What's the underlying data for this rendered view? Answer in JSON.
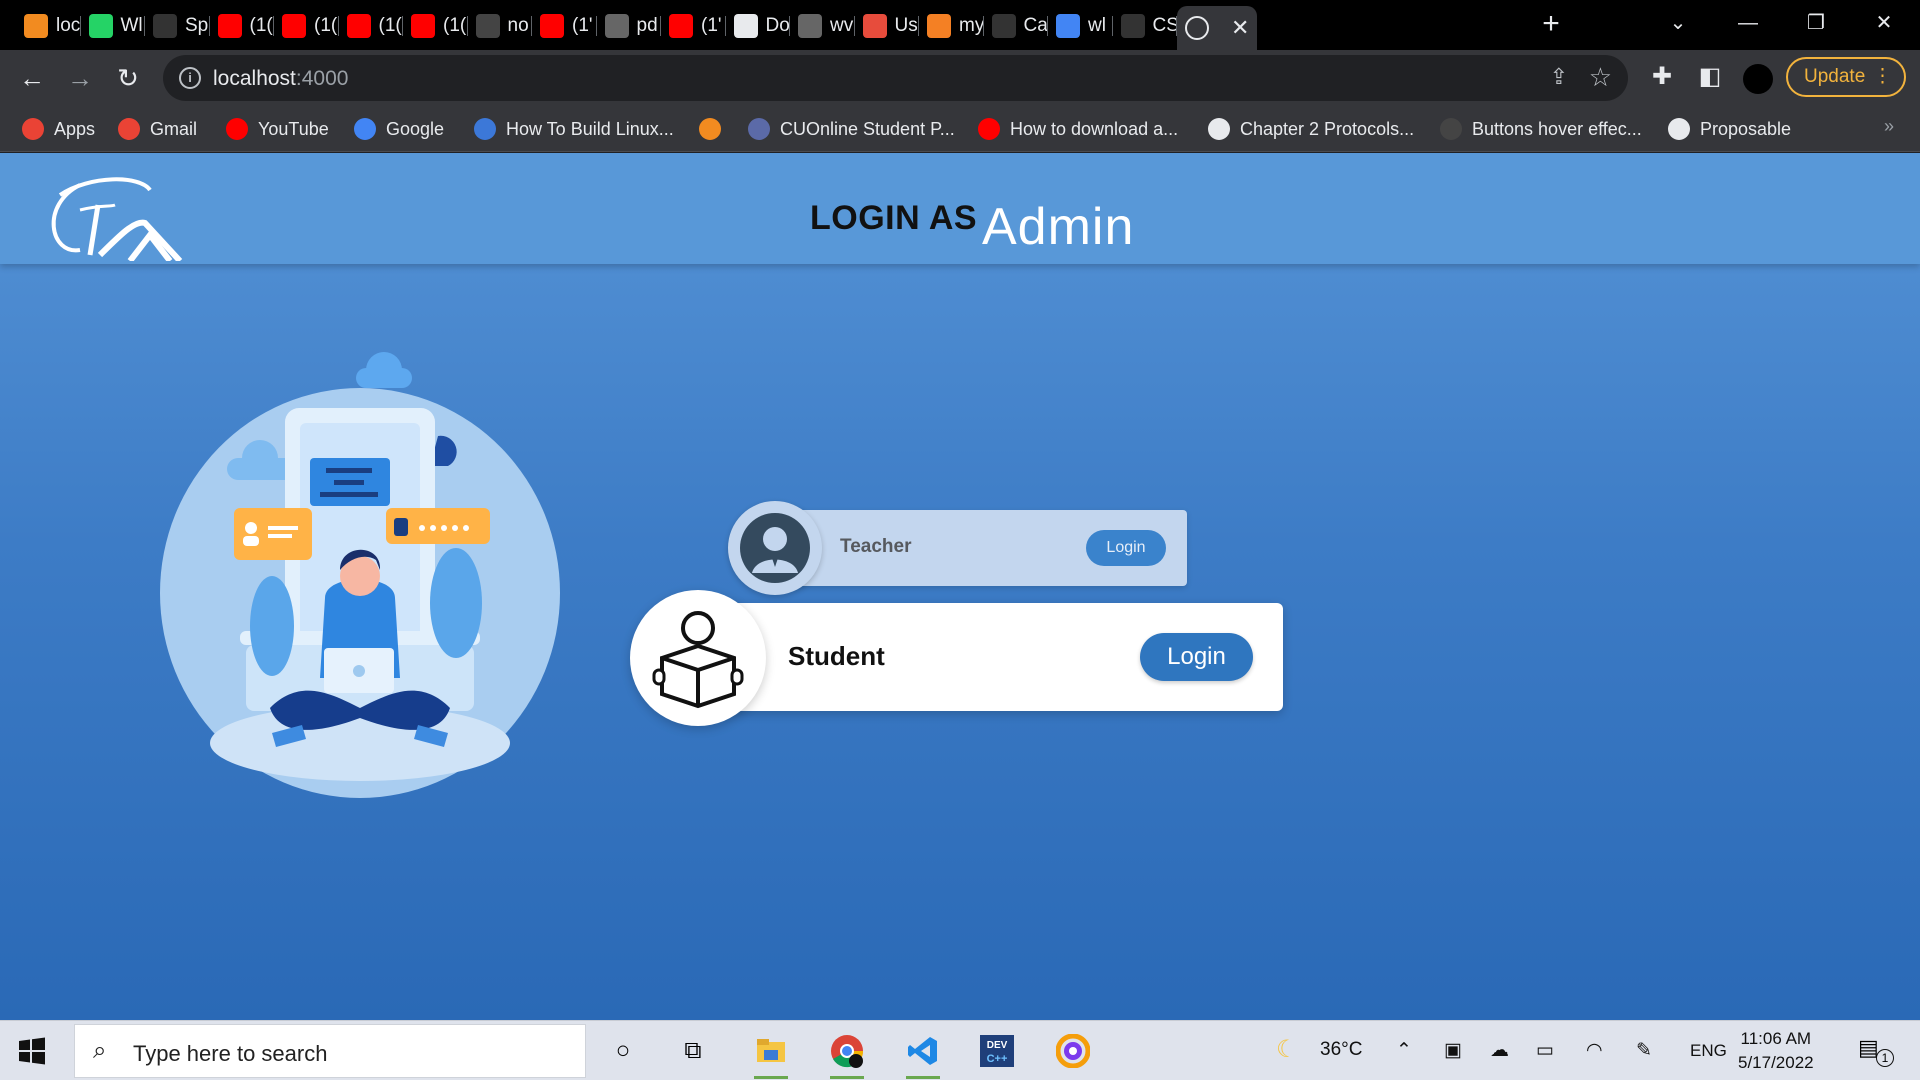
{
  "browser": {
    "tabs": [
      {
        "title": "loc",
        "favicon": "xampp-icon",
        "color": "#f28b20"
      },
      {
        "title": "Wl",
        "favicon": "whatsapp-icon",
        "color": "#25d366"
      },
      {
        "title": "Sp",
        "favicon": "codepen-icon",
        "color": "#333333"
      },
      {
        "title": "(1(",
        "favicon": "youtube-icon",
        "color": "#ff0000"
      },
      {
        "title": "(1(",
        "favicon": "youtube-icon",
        "color": "#ff0000"
      },
      {
        "title": "(1(",
        "favicon": "youtube-icon",
        "color": "#ff0000"
      },
      {
        "title": "(1(",
        "favicon": "youtube-icon",
        "color": "#ff0000"
      },
      {
        "title": "no",
        "favicon": "github-icon",
        "color": "#444444"
      },
      {
        "title": "(1'",
        "favicon": "youtube-icon",
        "color": "#ff0000"
      },
      {
        "title": "pd",
        "favicon": "globe-icon",
        "color": "#666666"
      },
      {
        "title": "(1'",
        "favicon": "youtube-icon",
        "color": "#ff0000"
      },
      {
        "title": "Do",
        "favicon": "docs-icon",
        "color": "#e8eaed"
      },
      {
        "title": "wv",
        "favicon": "w3-icon",
        "color": "#666666"
      },
      {
        "title": "Us",
        "favicon": "hash-icon",
        "color": "#e74c3c"
      },
      {
        "title": "my",
        "favicon": "stackoverflow-icon",
        "color": "#f48024"
      },
      {
        "title": "Ca",
        "favicon": "codepen-icon",
        "color": "#333333"
      },
      {
        "title": "wl",
        "favicon": "google-icon",
        "color": "#4285f4"
      },
      {
        "title": "CS",
        "favicon": "codepen-icon",
        "color": "#333333"
      },
      {
        "title": "",
        "favicon": "globe-icon",
        "color": "#e8eaed",
        "active": true
      }
    ],
    "new_tab_glyph": "+",
    "window_controls": {
      "tab_search": "⌄",
      "minimize": "—",
      "restore": "❐",
      "close": "✕"
    },
    "toolbar": {
      "back": "←",
      "forward": "→",
      "reload": "↻",
      "url_host": "localhost",
      "url_port": ":4000",
      "update_label": "Update",
      "update_menu": "⋮"
    },
    "bookmarks": [
      {
        "label": "Apps",
        "icon": "apps-grid-icon",
        "color": "#ea4335"
      },
      {
        "label": "Gmail",
        "icon": "gmail-icon",
        "color": "#ea4335"
      },
      {
        "label": "YouTube",
        "icon": "youtube-icon",
        "color": "#ff0000"
      },
      {
        "label": "Google",
        "icon": "google-icon",
        "color": "#4285f4"
      },
      {
        "label": "How To Build Linux...",
        "icon": "linux-icon",
        "color": "#3c78d8"
      },
      {
        "label": "",
        "icon": "xampp-icon",
        "color": "#f28b20"
      },
      {
        "label": "CUOnline Student P...",
        "icon": "cu-icon",
        "color": "#5b6aa8"
      },
      {
        "label": "How to download a...",
        "icon": "youtube-icon",
        "color": "#ff0000"
      },
      {
        "label": "Chapter 2 Protocols...",
        "icon": "globe-icon",
        "color": "#e8eaed"
      },
      {
        "label": "Buttons hover effec...",
        "icon": "circle-icon",
        "color": "#444444"
      },
      {
        "label": "Proposable",
        "icon": "globe-icon",
        "color": "#e8eaed"
      }
    ],
    "bookmarks_overflow": "»"
  },
  "page": {
    "header_title": "LOGIN AS",
    "animated_role": "Admin",
    "teacher_card": {
      "label": "Teacher",
      "button": "Login"
    },
    "student_card": {
      "label": "Student",
      "button": "Login"
    },
    "colors": {
      "header": "#5898d8",
      "login_button": "#2f76bf"
    }
  },
  "taskbar": {
    "search_placeholder": "Type here to search",
    "weather": "36°C",
    "language": "ENG",
    "time": "11:06 AM",
    "date": "5/17/2022",
    "notification_count": "1"
  }
}
